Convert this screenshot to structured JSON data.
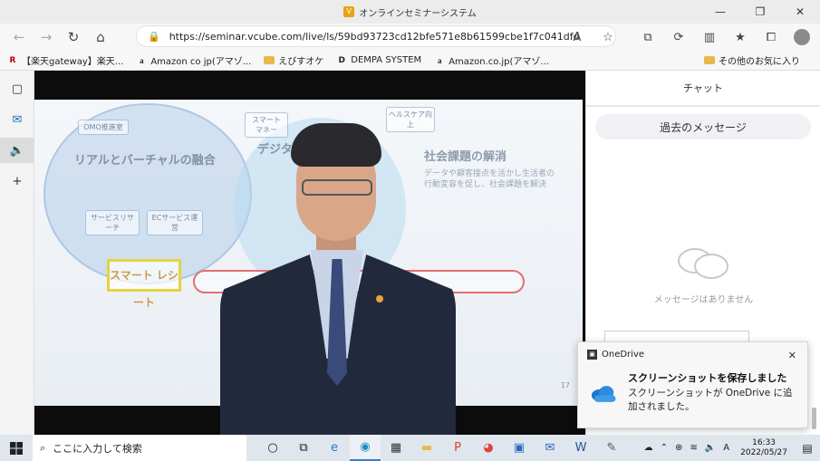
{
  "window": {
    "title": "オンラインセミナーシステム",
    "minimize": "—",
    "maximize": "❐",
    "close": "✕"
  },
  "toolbar": {
    "back": "←",
    "forward": "→",
    "refresh": "↻",
    "home": "⌂",
    "url": "https://seminar.vcube.com/live/ls/59bd93723cd12bfe571e8b61599cbe1f7c041dfd",
    "read_aloud": "A",
    "add_fav": "☆",
    "ext": "⧉",
    "refresh2": "⟳",
    "split": "▥",
    "favorites": "★",
    "collections": "⧠",
    "more": "···"
  },
  "favorites": [
    {
      "icon": "R",
      "label": "【楽天gateway】楽天..."
    },
    {
      "icon": "a",
      "label": "Amazon co jp(アマゾ..."
    },
    {
      "icon": "folder",
      "label": "えびすオケ"
    },
    {
      "icon": "D",
      "label": "DEMPA SYSTEM"
    },
    {
      "icon": "a",
      "label": "Amazon.co.jp(アマゾ..."
    }
  ],
  "favorites_other": "その他のお気に入り",
  "sidebar": {
    "tabs": "▢",
    "outlook": "✉",
    "audio": "🔈",
    "add": "+"
  },
  "slide": {
    "t1": "リアルとバーチャルの融合",
    "t2": "デジタル",
    "t3": "社会課題の解消",
    "s1": "データや顧客接点を活かし生活者の",
    "s2": "行動変容を促し、社会課題を解決",
    "smart": "スマート レシート",
    "box1": "OMO推進室",
    "box2": "スマート マネー",
    "box3": "ヘルスケア向上",
    "box4": "サービスリサーチ",
    "box5": "ECサービス運営",
    "page": "17"
  },
  "chat": {
    "tab": "チャット",
    "past_messages": "過去のメッセージ",
    "empty": "メッセージはありません"
  },
  "toast": {
    "app": "OneDrive",
    "heading": "スクリーンショットを保存しました",
    "body": "スクリーンショットが OneDrive に追加されました。",
    "close": "✕"
  },
  "taskbar": {
    "search_placeholder": "ここに入力して検索",
    "time": "16:33",
    "date": "2022/05/27",
    "ime": "A"
  }
}
